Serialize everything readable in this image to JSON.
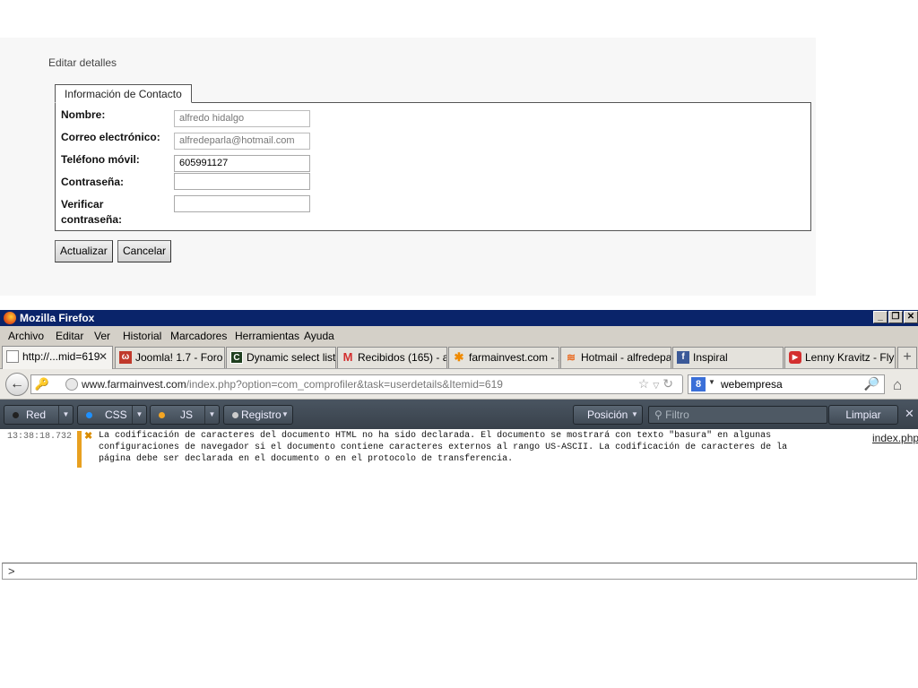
{
  "webpage": {
    "title": "Editar detalles",
    "fieldset_legend": "Información de Contacto",
    "fields": [
      {
        "label": "Nombre:",
        "value": "alfredo hidalgo"
      },
      {
        "label": "Correo electrónico:",
        "value": "alfredeparla@hotmail.com"
      },
      {
        "label": "Teléfono móvil:",
        "value": "605991127"
      },
      {
        "label": "Contraseña:",
        "value": ""
      },
      {
        "label": "Verificar contraseña:",
        "value": ""
      }
    ],
    "buttons": {
      "update": "Actualizar",
      "cancel": "Cancelar"
    }
  },
  "browser": {
    "window_title": "Mozilla Firefox",
    "menu": [
      "Archivo",
      "Editar",
      "Ver",
      "Historial",
      "Marcadores",
      "Herramientas",
      "Ayuda"
    ],
    "tabs": [
      {
        "label": "http://...mid=619",
        "icon": "blank-page-icon"
      },
      {
        "label": "Joomla! 1.7 - Foro ...",
        "icon": "joomla-icon"
      },
      {
        "label": "Dynamic select list ...",
        "icon": "codeproject-icon"
      },
      {
        "label": "Recibidos (165) - al...",
        "icon": "gmail-icon"
      },
      {
        "label": "farmainvest.com - ...",
        "icon": "joomla-icon"
      },
      {
        "label": "Hotmail - alfredepar...",
        "icon": "hotmail-icon"
      },
      {
        "label": "Inspiral",
        "icon": "facebook-icon"
      },
      {
        "label": "Lenny Kravitz - Fly ...",
        "icon": "youtube-icon"
      }
    ],
    "new_tab": "+",
    "url_domain": "www.farmainvest.com",
    "url_path": "/index.php?option=com_comprofiler&task=userdetails&Itemid=619",
    "search_value": "webempresa",
    "search_engine": "8"
  },
  "devtools": {
    "buttons": [
      "Red",
      "CSS",
      "JS",
      "Registro"
    ],
    "dot_colors": [
      "#222222",
      "#1e90ff",
      "#f5a623",
      "#cccccc"
    ],
    "position_label": "Posición",
    "filter_placeholder": "Filtro",
    "clear_label": "Limpiar",
    "close": "✕",
    "message": {
      "timestamp": "13:38:18.732",
      "text": "La codificación de caracteres del documento HTML no ha sido declarada. El documento se mostrará con texto \"basura\" en algunas\nconfiguraciones de navegador si el documento contiene caracteres externos al rango US-ASCII. La codificación de caracteres de la\npágina debe ser declarada en el documento o en el protocolo de transferencia.",
      "source": "index.php"
    },
    "prompt": ">"
  }
}
